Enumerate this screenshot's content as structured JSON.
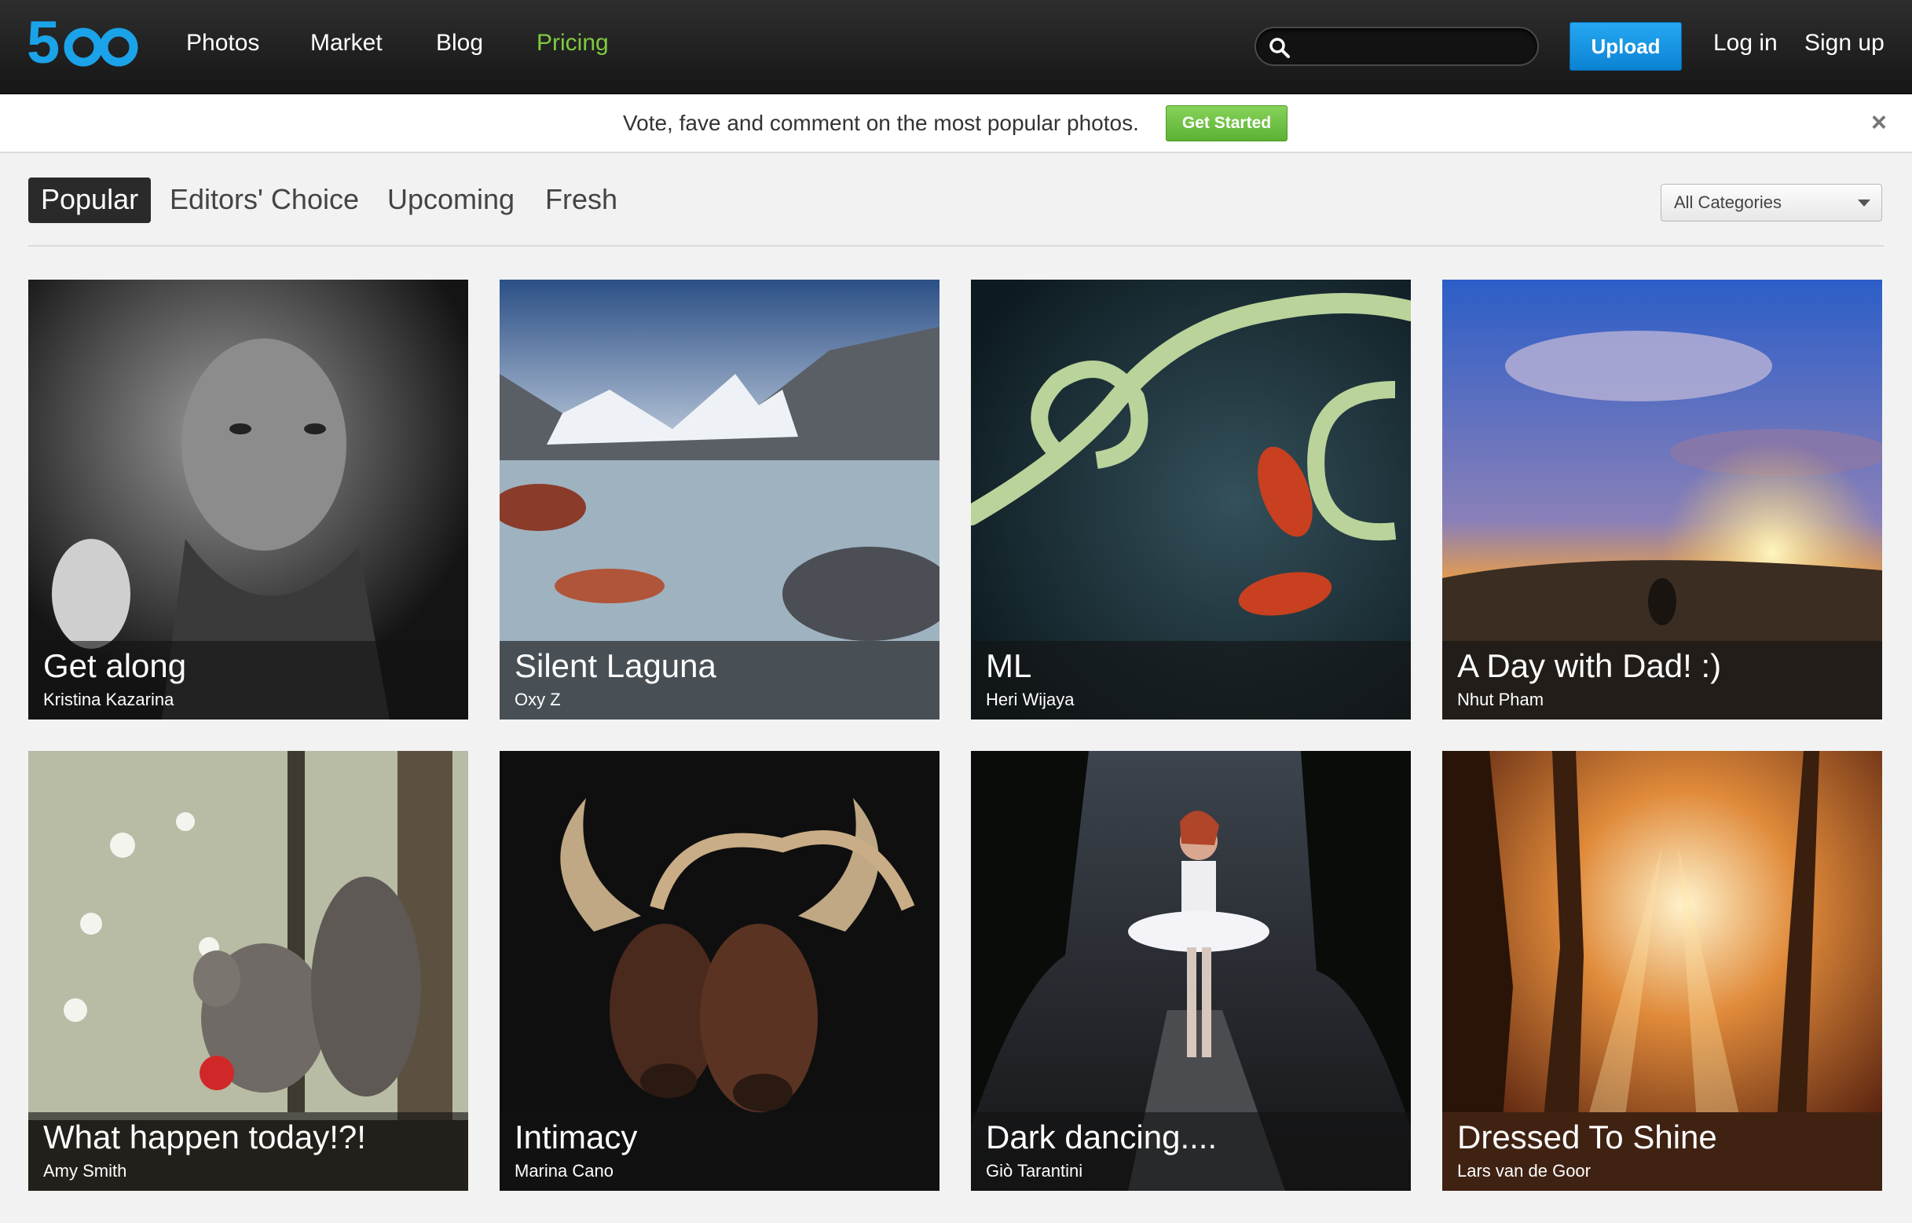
{
  "nav": {
    "logo_text": "500px",
    "links": [
      "Photos",
      "Market",
      "Blog",
      "Pricing"
    ],
    "active_link": "Pricing",
    "search_placeholder": "",
    "upload_label": "Upload",
    "login_label": "Log in",
    "signup_label": "Sign up"
  },
  "promo": {
    "text": "Vote, fave and comment on the most popular photos.",
    "button_label": "Get Started",
    "close_glyph": "×"
  },
  "tabs": [
    "Popular",
    "Editors' Choice",
    "Upcoming",
    "Fresh"
  ],
  "category_select": {
    "value": "All Categories"
  },
  "photos": [
    {
      "title": "Get along",
      "author": "Kristina Kazarina"
    },
    {
      "title": "Silent Laguna",
      "author": "Oxy Z"
    },
    {
      "title": "ML",
      "author": "Heri Wijaya"
    },
    {
      "title": "A Day with Dad! :)",
      "author": "Nhut Pham"
    },
    {
      "title": "What happen today!?!",
      "author": "Amy Smith"
    },
    {
      "title": "Intimacy",
      "author": "Marina Cano"
    },
    {
      "title": "Dark dancing....",
      "author": "Giò Tarantini"
    },
    {
      "title": "Dressed To Shine",
      "author": "Lars van de Goor"
    }
  ],
  "colors": {
    "brand_blue": "#1aa3e8",
    "pricing_green": "#7fcb3f",
    "upload_blue": "#1595e4",
    "get_started_green": "#6cc043"
  },
  "icons": {
    "search": "search-icon",
    "close": "close-icon",
    "dropdown": "chevron-down-icon"
  }
}
